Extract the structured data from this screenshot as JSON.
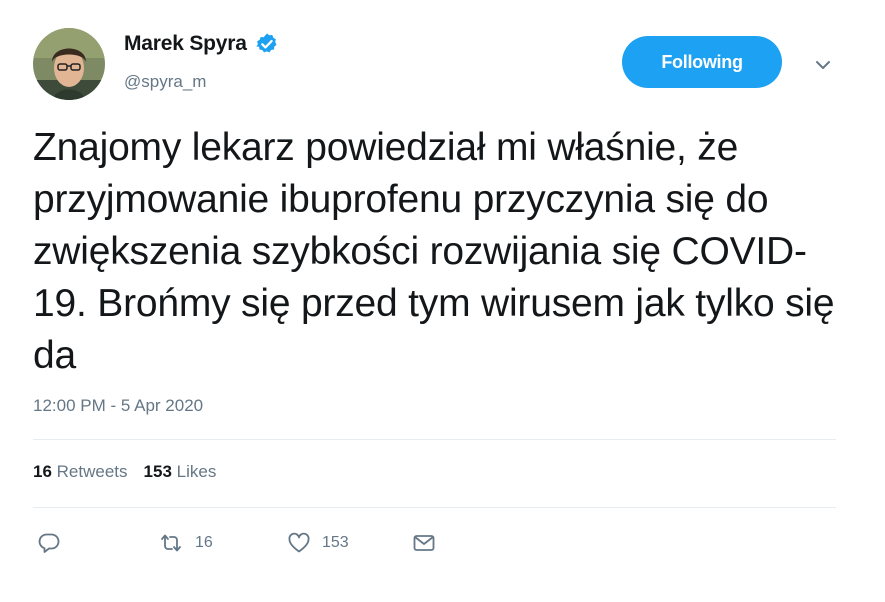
{
  "author": {
    "display_name": "Marek Spyra",
    "handle": "@spyra_m",
    "verified": true,
    "avatar_icon": "user-avatar-photo"
  },
  "follow_button": {
    "label": "Following",
    "color": "#1da1f2"
  },
  "menu_icon": "chevron-down-icon",
  "tweet": {
    "text": "Znajomy lekarz powiedział mi właśnie, że przyjmowanie ibuprofenu przyczynia się do zwiększenia szybkości rozwijania się COVID-19. Brońmy się przed tym wirusem jak tylko się da",
    "timestamp": "12:00 PM - 5 Apr 2020"
  },
  "stats": {
    "retweets_count": "16",
    "retweets_label": "Retweets",
    "likes_count": "153",
    "likes_label": "Likes"
  },
  "actions": {
    "reply_icon": "reply-icon",
    "retweet_icon": "retweet-icon",
    "retweet_count": "16",
    "like_icon": "heart-icon",
    "like_count": "153",
    "dm_icon": "mail-icon"
  },
  "colors": {
    "text": "#14171a",
    "secondary": "#657786",
    "accent": "#1da1f2",
    "divider": "#e6ecf0"
  }
}
